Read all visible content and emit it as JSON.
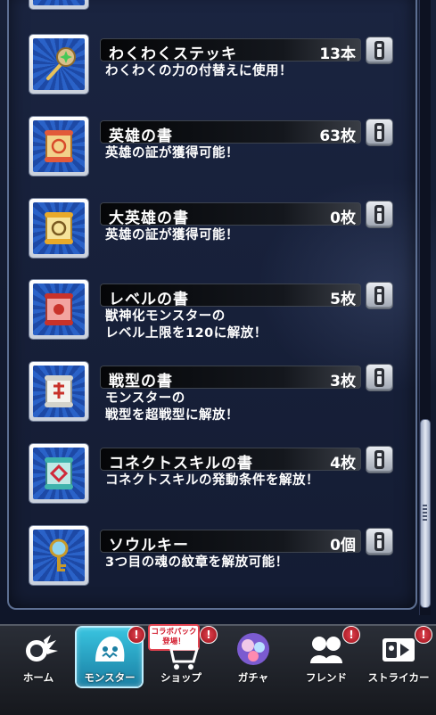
{
  "items": [
    {
      "name": "わくわくステッキ",
      "count": "13本",
      "desc": "わくわくの力の付替えに使用！",
      "icon": "wakuwaku-stick-icon"
    },
    {
      "name": "英雄の書",
      "count": "63枚",
      "desc": "英雄の証が獲得可能！",
      "icon": "hero-book-icon"
    },
    {
      "name": "大英雄の書",
      "count": "0枚",
      "desc": "英雄の証が獲得可能！",
      "icon": "great-hero-book-icon"
    },
    {
      "name": "レベルの書",
      "count": "5枚",
      "desc": "獣神化モンスターの\nレベル上限を120に解放！",
      "icon": "level-book-icon"
    },
    {
      "name": "戦型の書",
      "count": "3枚",
      "desc": "モンスターの\n戦型を超戦型に解放！",
      "icon": "battle-type-book-icon"
    },
    {
      "name": "コネクトスキルの書",
      "count": "4枚",
      "desc": "コネクトスキルの発動条件を解放！",
      "icon": "connect-skill-book-icon"
    },
    {
      "name": "ソウルキー",
      "count": "0個",
      "desc": "3つ目の魂の紋章を解放可能！",
      "icon": "soul-key-icon"
    }
  ],
  "nav": [
    {
      "label": "ホーム",
      "icon": "home-icon"
    },
    {
      "label": "モンスター",
      "icon": "monster-icon"
    },
    {
      "label": "ショップ",
      "icon": "shop-cart-icon"
    },
    {
      "label": "ガチャ",
      "icon": "gacha-icon"
    },
    {
      "label": "フレンド",
      "icon": "friend-icon"
    },
    {
      "label": "ストライカー",
      "icon": "striker-card-icon"
    }
  ],
  "collab_badge": "コラボパック\n登場！",
  "badge_text": "!",
  "colors": {
    "accent": "#39c4e0",
    "badge": "#e0424f",
    "tile": "#2a62c8"
  }
}
